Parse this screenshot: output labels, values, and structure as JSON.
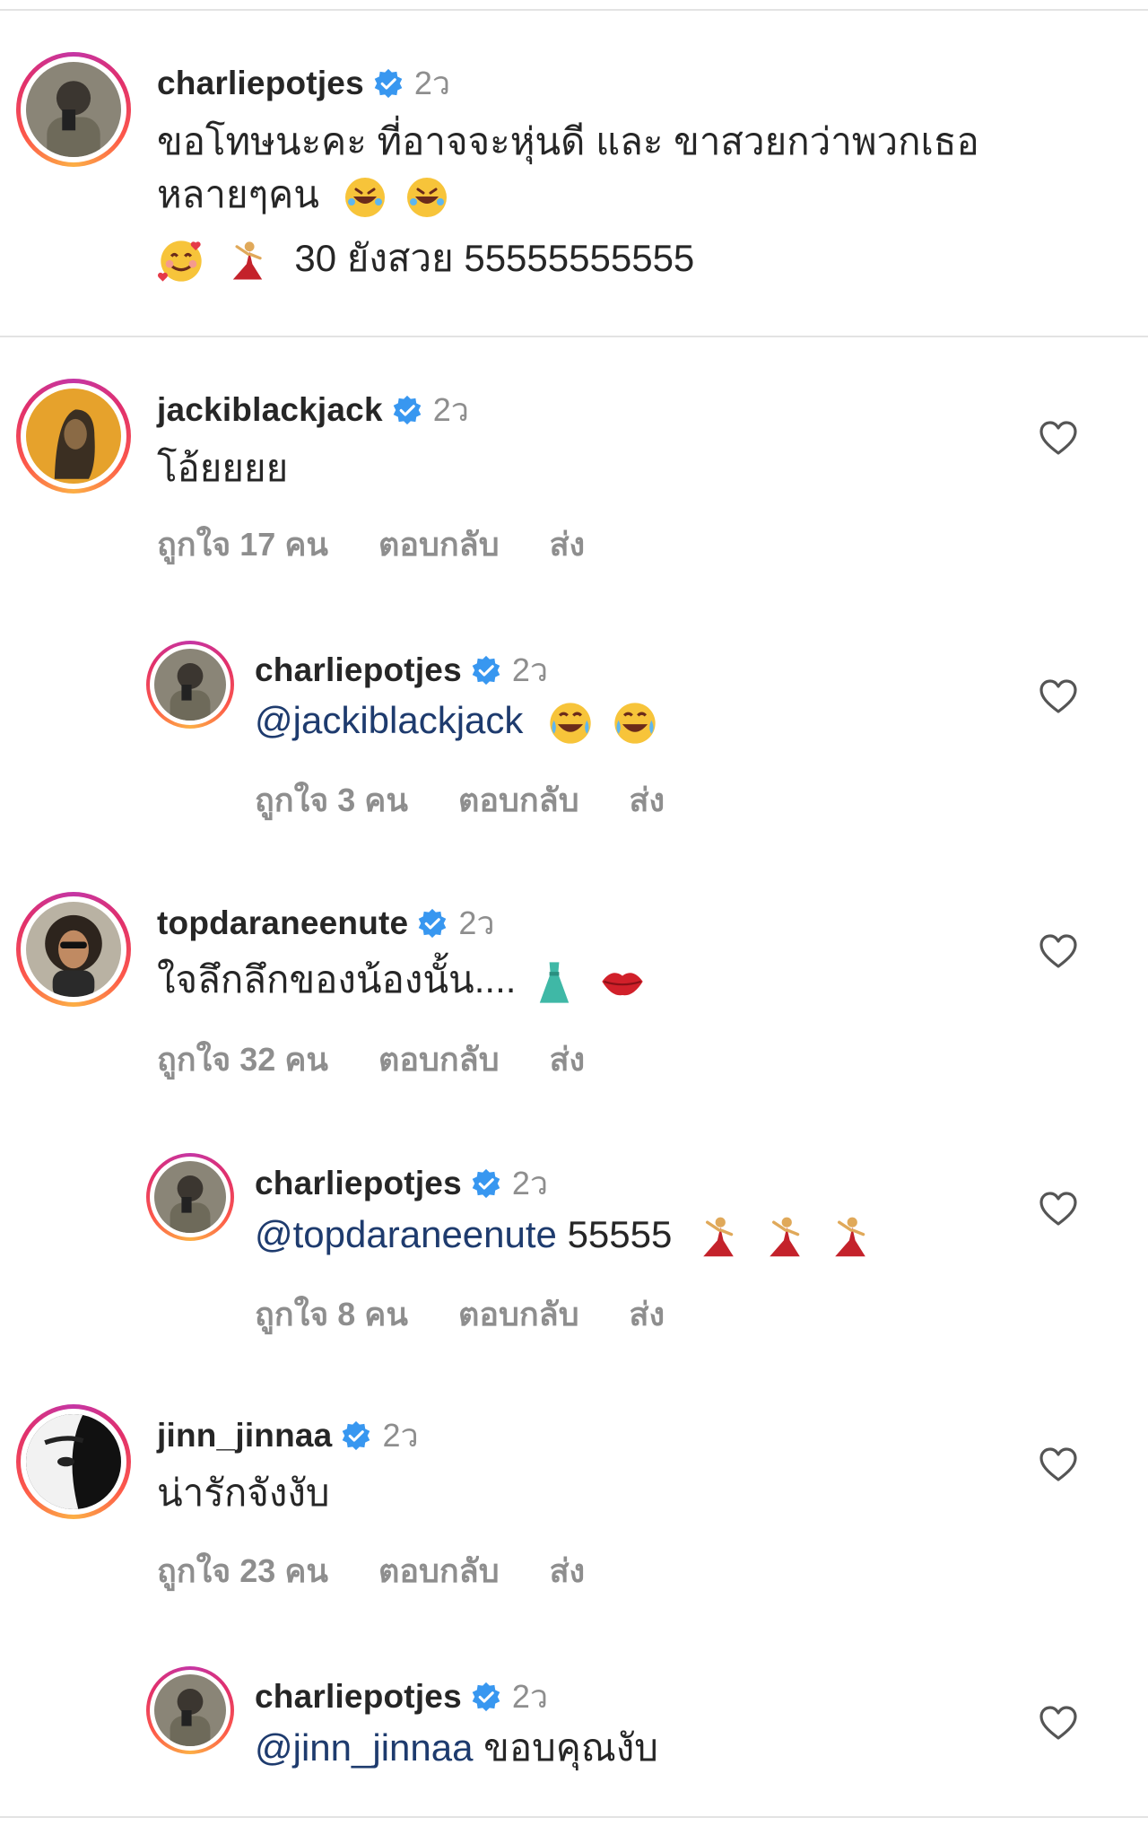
{
  "comments": [
    {
      "username": "charliepotjes",
      "time": "2ว",
      "line1": "ขอโทษนะคะ ที่อาจจะหุ่นดี และ ขาสวยกว่าพวกเธอ",
      "line2": "หลายๆคน",
      "line3": "30 ยังสวย 55555555555"
    },
    {
      "username": "jackiblackjack",
      "time": "2ว",
      "text": "โอ้ยยยย",
      "likes": "ถูกใจ 17 คน",
      "reply": "ตอบกลับ",
      "send": "ส่ง"
    },
    {
      "username": "charliepotjes",
      "time": "2ว",
      "mention": "@jackiblackjack",
      "text": "",
      "likes": "ถูกใจ 3 คน",
      "reply": "ตอบกลับ",
      "send": "ส่ง"
    },
    {
      "username": "topdaraneenute",
      "time": "2ว",
      "text": "ใจลึกลึกของน้องนั้น....",
      "likes": "ถูกใจ 32 คน",
      "reply": "ตอบกลับ",
      "send": "ส่ง"
    },
    {
      "username": "charliepotjes",
      "time": "2ว",
      "mention": "@topdaraneenute",
      "text": " 55555",
      "likes": "ถูกใจ 8 คน",
      "reply": "ตอบกลับ",
      "send": "ส่ง"
    },
    {
      "username": "jinn_jinnaa",
      "time": "2ว",
      "text": "น่ารักจังงับ",
      "likes": "ถูกใจ 23 คน",
      "reply": "ตอบกลับ",
      "send": "ส่ง"
    },
    {
      "username": "charliepotjes",
      "time": "2ว",
      "mention": "@jinn_jinnaa",
      "text": " ขอบคุณงับ"
    }
  ],
  "colors": {
    "verified": "#3897f0",
    "mention": "#1e3b6e",
    "muted": "#8e8e8e"
  }
}
